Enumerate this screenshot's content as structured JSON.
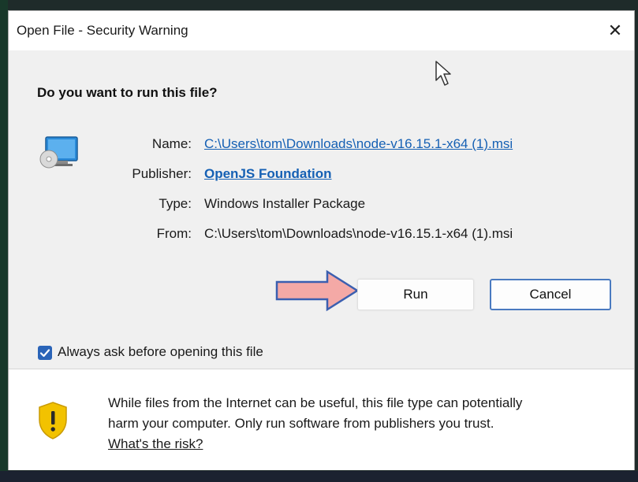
{
  "window": {
    "title": "Open File - Security Warning",
    "close_glyph": "✕"
  },
  "prompt": {
    "question": "Do you want to run this file?"
  },
  "file_info": {
    "name_label": "Name:",
    "name_value": "C:\\Users\\tom\\Downloads\\node-v16.15.1-x64 (1).msi",
    "publisher_label": "Publisher:",
    "publisher_value": "OpenJS Foundation",
    "type_label": "Type:",
    "type_value": "Windows Installer Package",
    "from_label": "From:",
    "from_value": "C:\\Users\\tom\\Downloads\\node-v16.15.1-x64 (1).msi"
  },
  "buttons": {
    "run_label": "Run",
    "cancel_label": "Cancel"
  },
  "checkbox": {
    "label": "Always ask before opening this file",
    "checked": true
  },
  "warning": {
    "line1": "While files from the Internet can be useful, this file type can potentially",
    "line2": "harm your computer. Only run software from publishers you trust.",
    "risk_link": "What's the risk?"
  },
  "icons": {
    "file": "installer-file-icon",
    "shield": "warning-shield-icon",
    "arrow": "annotation-arrow-icon",
    "cursor": "mouse-cursor-icon"
  },
  "colors": {
    "link": "#1560b4",
    "accent": "#2a64b8",
    "shield": "#f2c200",
    "arrow_fill": "#f4a9a6",
    "arrow_stroke": "#3b5fb0"
  }
}
